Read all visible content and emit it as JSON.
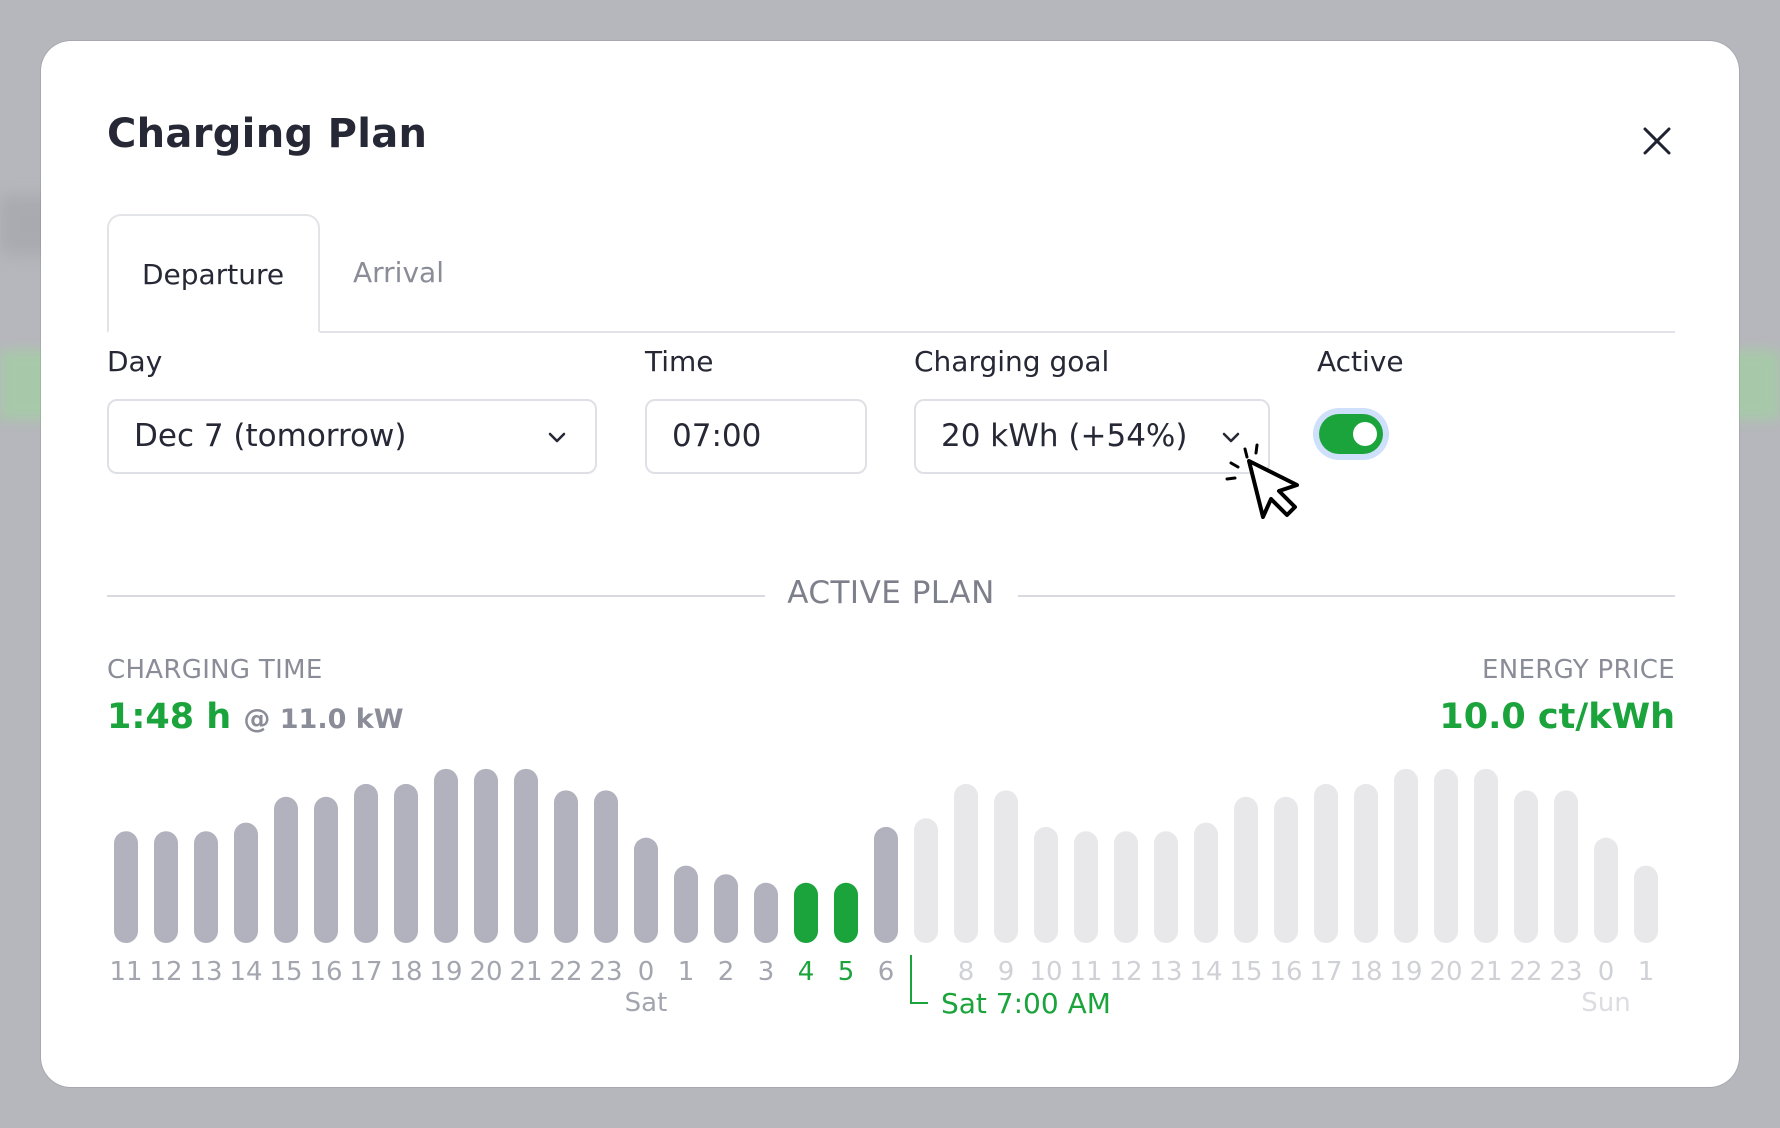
{
  "modal": {
    "title": "Charging Plan"
  },
  "tabs": [
    {
      "label": "Departure",
      "active": true
    },
    {
      "label": "Arrival",
      "active": false
    }
  ],
  "form": {
    "day_label": "Day",
    "day_value": "Dec 7 (tomorrow)",
    "time_label": "Time",
    "time_value": "07:00",
    "goal_label": "Charging goal",
    "goal_value": "20 kWh (+54%)",
    "active_label": "Active",
    "active_on": true
  },
  "plan": {
    "section_label": "ACTIVE PLAN",
    "charging_time_label": "CHARGING TIME",
    "charging_time_value": "1:48 h",
    "charging_power": "@ 11.0 kW",
    "energy_price_label": "ENERGY PRICE",
    "energy_price_value": "10.0 ct/kWh"
  },
  "colors": {
    "accent_green": "#1ba33c",
    "bar_past": "#b1b2bd",
    "bar_future": "#e8e8eb",
    "tick_future": "#d0d1d6"
  },
  "icons": {
    "close": "close-icon",
    "chevron": "chevron-down-icon",
    "cursor": "pointer-cursor-icon"
  },
  "chart_data": {
    "type": "bar",
    "categories": [
      "11",
      "12",
      "13",
      "14",
      "15",
      "16",
      "17",
      "18",
      "19",
      "20",
      "21",
      "22",
      "23",
      "0",
      "1",
      "2",
      "3",
      "4",
      "5",
      "6",
      "7",
      "8",
      "9",
      "10",
      "11",
      "12",
      "13",
      "14",
      "15",
      "16",
      "17",
      "18",
      "19",
      "20",
      "21",
      "22",
      "23",
      "0",
      "1"
    ],
    "values": [
      5.2,
      5.2,
      5.2,
      5.6,
      6.8,
      6.8,
      7.4,
      7.4,
      8.1,
      8.1,
      8.1,
      7.1,
      7.1,
      4.9,
      3.6,
      3.2,
      2.8,
      2.8,
      2.8,
      5.4,
      5.8,
      7.4,
      7.1,
      5.4,
      5.2,
      5.2,
      5.2,
      5.6,
      6.8,
      6.8,
      7.4,
      7.4,
      8.1,
      8.1,
      8.1,
      7.1,
      7.1,
      4.9,
      3.6
    ],
    "charging_slots": [
      "4",
      "5"
    ],
    "ticks_visible": [
      "11",
      "12",
      "13",
      "14",
      "15",
      "16",
      "17",
      "18",
      "19",
      "20",
      "21",
      "22",
      "23",
      "0",
      "1",
      "2",
      "3",
      "4",
      "5",
      "6",
      "",
      "8",
      "9",
      "10",
      "11",
      "12",
      "13",
      "14",
      "15",
      "16",
      "17",
      "18",
      "19",
      "20",
      "21",
      "22",
      "23",
      "0",
      "1"
    ],
    "day_labels": [
      {
        "label": "Sat",
        "index": 13
      },
      {
        "label": "Sun",
        "index": 37
      }
    ],
    "departure_marker": {
      "label": "Sat 7:00 AM",
      "index": 20
    },
    "future_from_index": 20,
    "title": "",
    "xlabel": "",
    "ylabel": ""
  }
}
